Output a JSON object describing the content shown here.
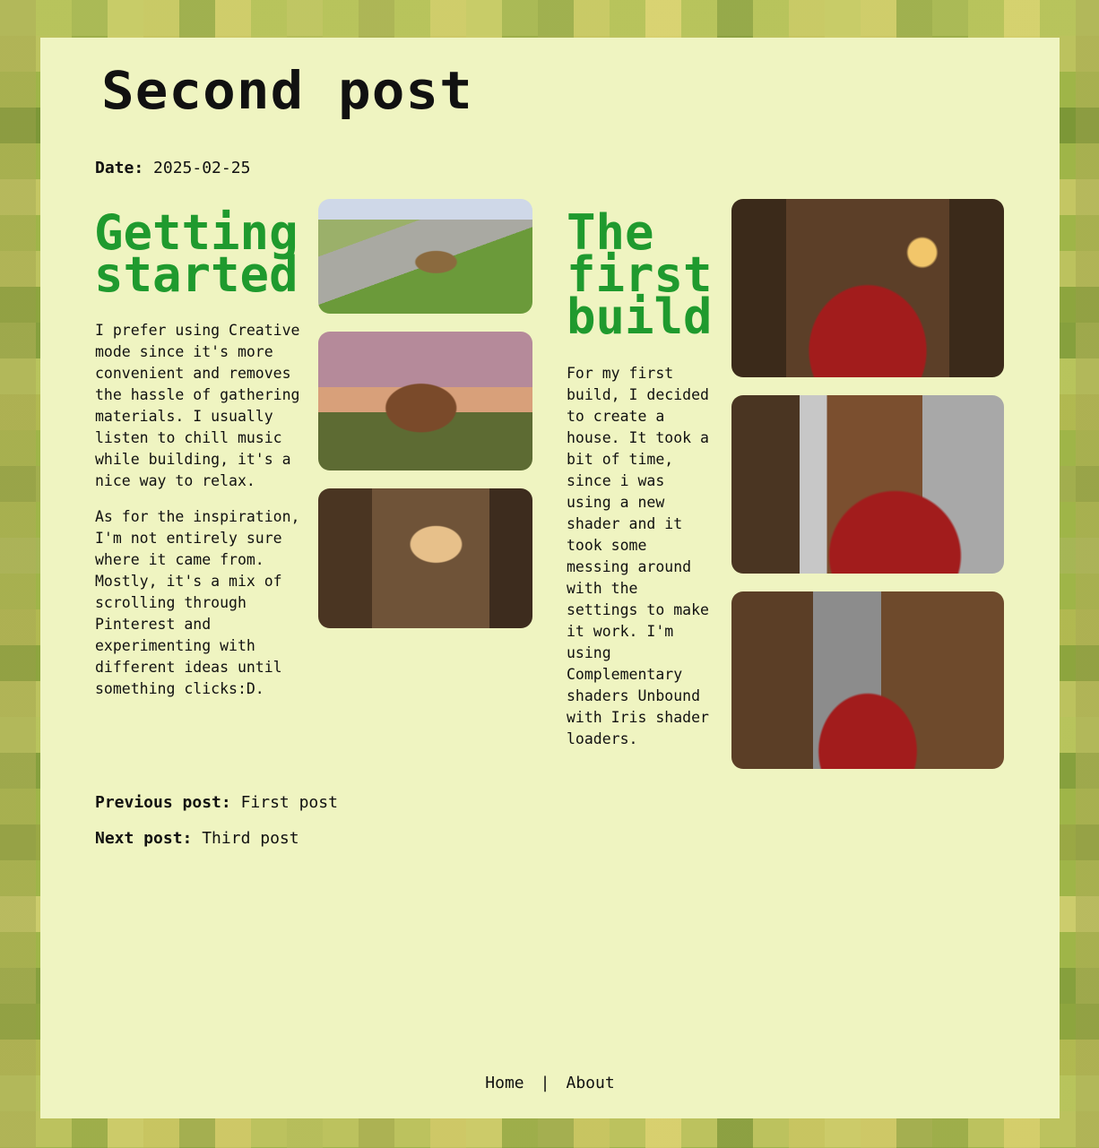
{
  "page": {
    "title": "Second post",
    "date_label": "Date:",
    "date_value": "2025-02-25"
  },
  "sections": [
    {
      "heading": "Getting started",
      "paragraphs": [
        "I prefer using Creative mode since it's more convenient and removes the hassle of gathering materials. I usually listen to chill music while building, it's a nice way to relax.",
        "As for the inspiration, I'm not entirely sure where it came from. Mostly, it's a mix of scrolling through Pinterest and experimenting with different ideas until something clicks:D."
      ],
      "images": [
        "minecraft-screenshot",
        "minecraft-screenshot",
        "minecraft-screenshot"
      ]
    },
    {
      "heading": "The first build",
      "paragraphs": [
        "For my first build, I decided to create a house. It took a bit of time, since i was using a new shader and it took some messing around with the settings to make it work. I'm using Complementary shaders Unbound with Iris shader loaders."
      ],
      "images": [
        "minecraft-screenshot",
        "minecraft-screenshot",
        "minecraft-screenshot"
      ]
    }
  ],
  "post_nav": {
    "previous_label": "Previous post:",
    "previous_link": "First post",
    "next_label": "Next post:",
    "next_link": "Third post"
  },
  "footer": {
    "home": "Home",
    "separator": "|",
    "about": "About"
  },
  "colors": {
    "card_background": "#eff4c1",
    "heading_green": "#1f9a2e",
    "text": "#111111"
  }
}
